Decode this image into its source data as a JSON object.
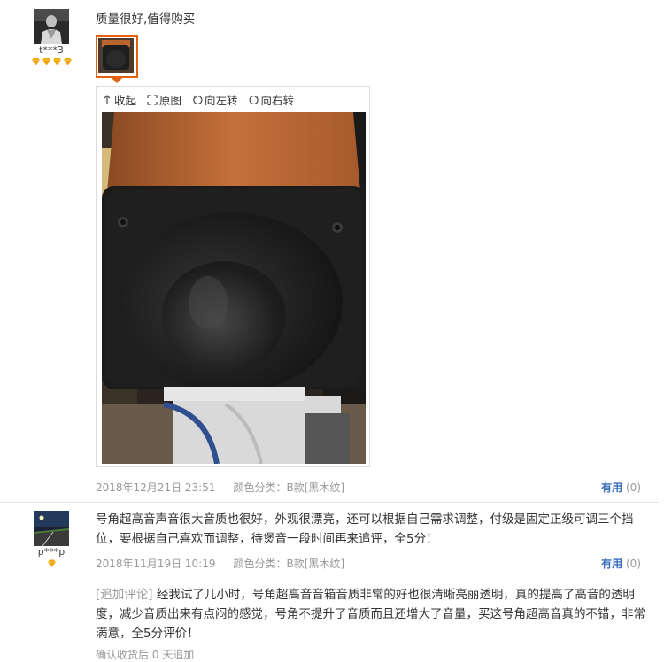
{
  "reviews": [
    {
      "username": "t***3",
      "level_icons": [
        "diamond-icon",
        "diamond-icon",
        "diamond-icon",
        "diamond-icon"
      ],
      "text": "质量很好,值得购买",
      "viewer_toolbar": {
        "collapse": "收起",
        "original": "原图",
        "rotate_left": "向左转",
        "rotate_right": "向右转"
      },
      "date": "2018年12月21日 23:51",
      "variant": "颜色分类：B款[黑木纹]",
      "useful_label": "有用",
      "useful_count": "(0)"
    },
    {
      "username": "p***p",
      "level_icons": [
        "diamond-icon"
      ],
      "text": "号角超高音声音很大音质也很好，外观很漂亮，还可以根据自己需求调整，付级是固定正级可调三个挡位，要根据自己喜欢而调整，待煲音一段时间再来追评，全5分！",
      "date": "2018年11月19日 10:19",
      "variant": "颜色分类：B款[黑木纹]",
      "useful_label": "有用",
      "useful_count": "(0)",
      "followup_label": "[追加评论]",
      "followup_text": "经我试了几小时，号角超高音音箱音质非常的好也很清晰亮丽透明，真的提高了高音的透明度，减少音质出来有点闷的感觉，号角不提升了音质而且还增大了音量，买这号角超高音真的不错，非常满意，全5分评价！",
      "followup_after": "确认收货后 0 天追加"
    }
  ],
  "colors": {
    "accent_orange": "#e4600f",
    "link_blue": "#3a6dbd",
    "muted": "#999999",
    "diamond": "#f0a400"
  }
}
